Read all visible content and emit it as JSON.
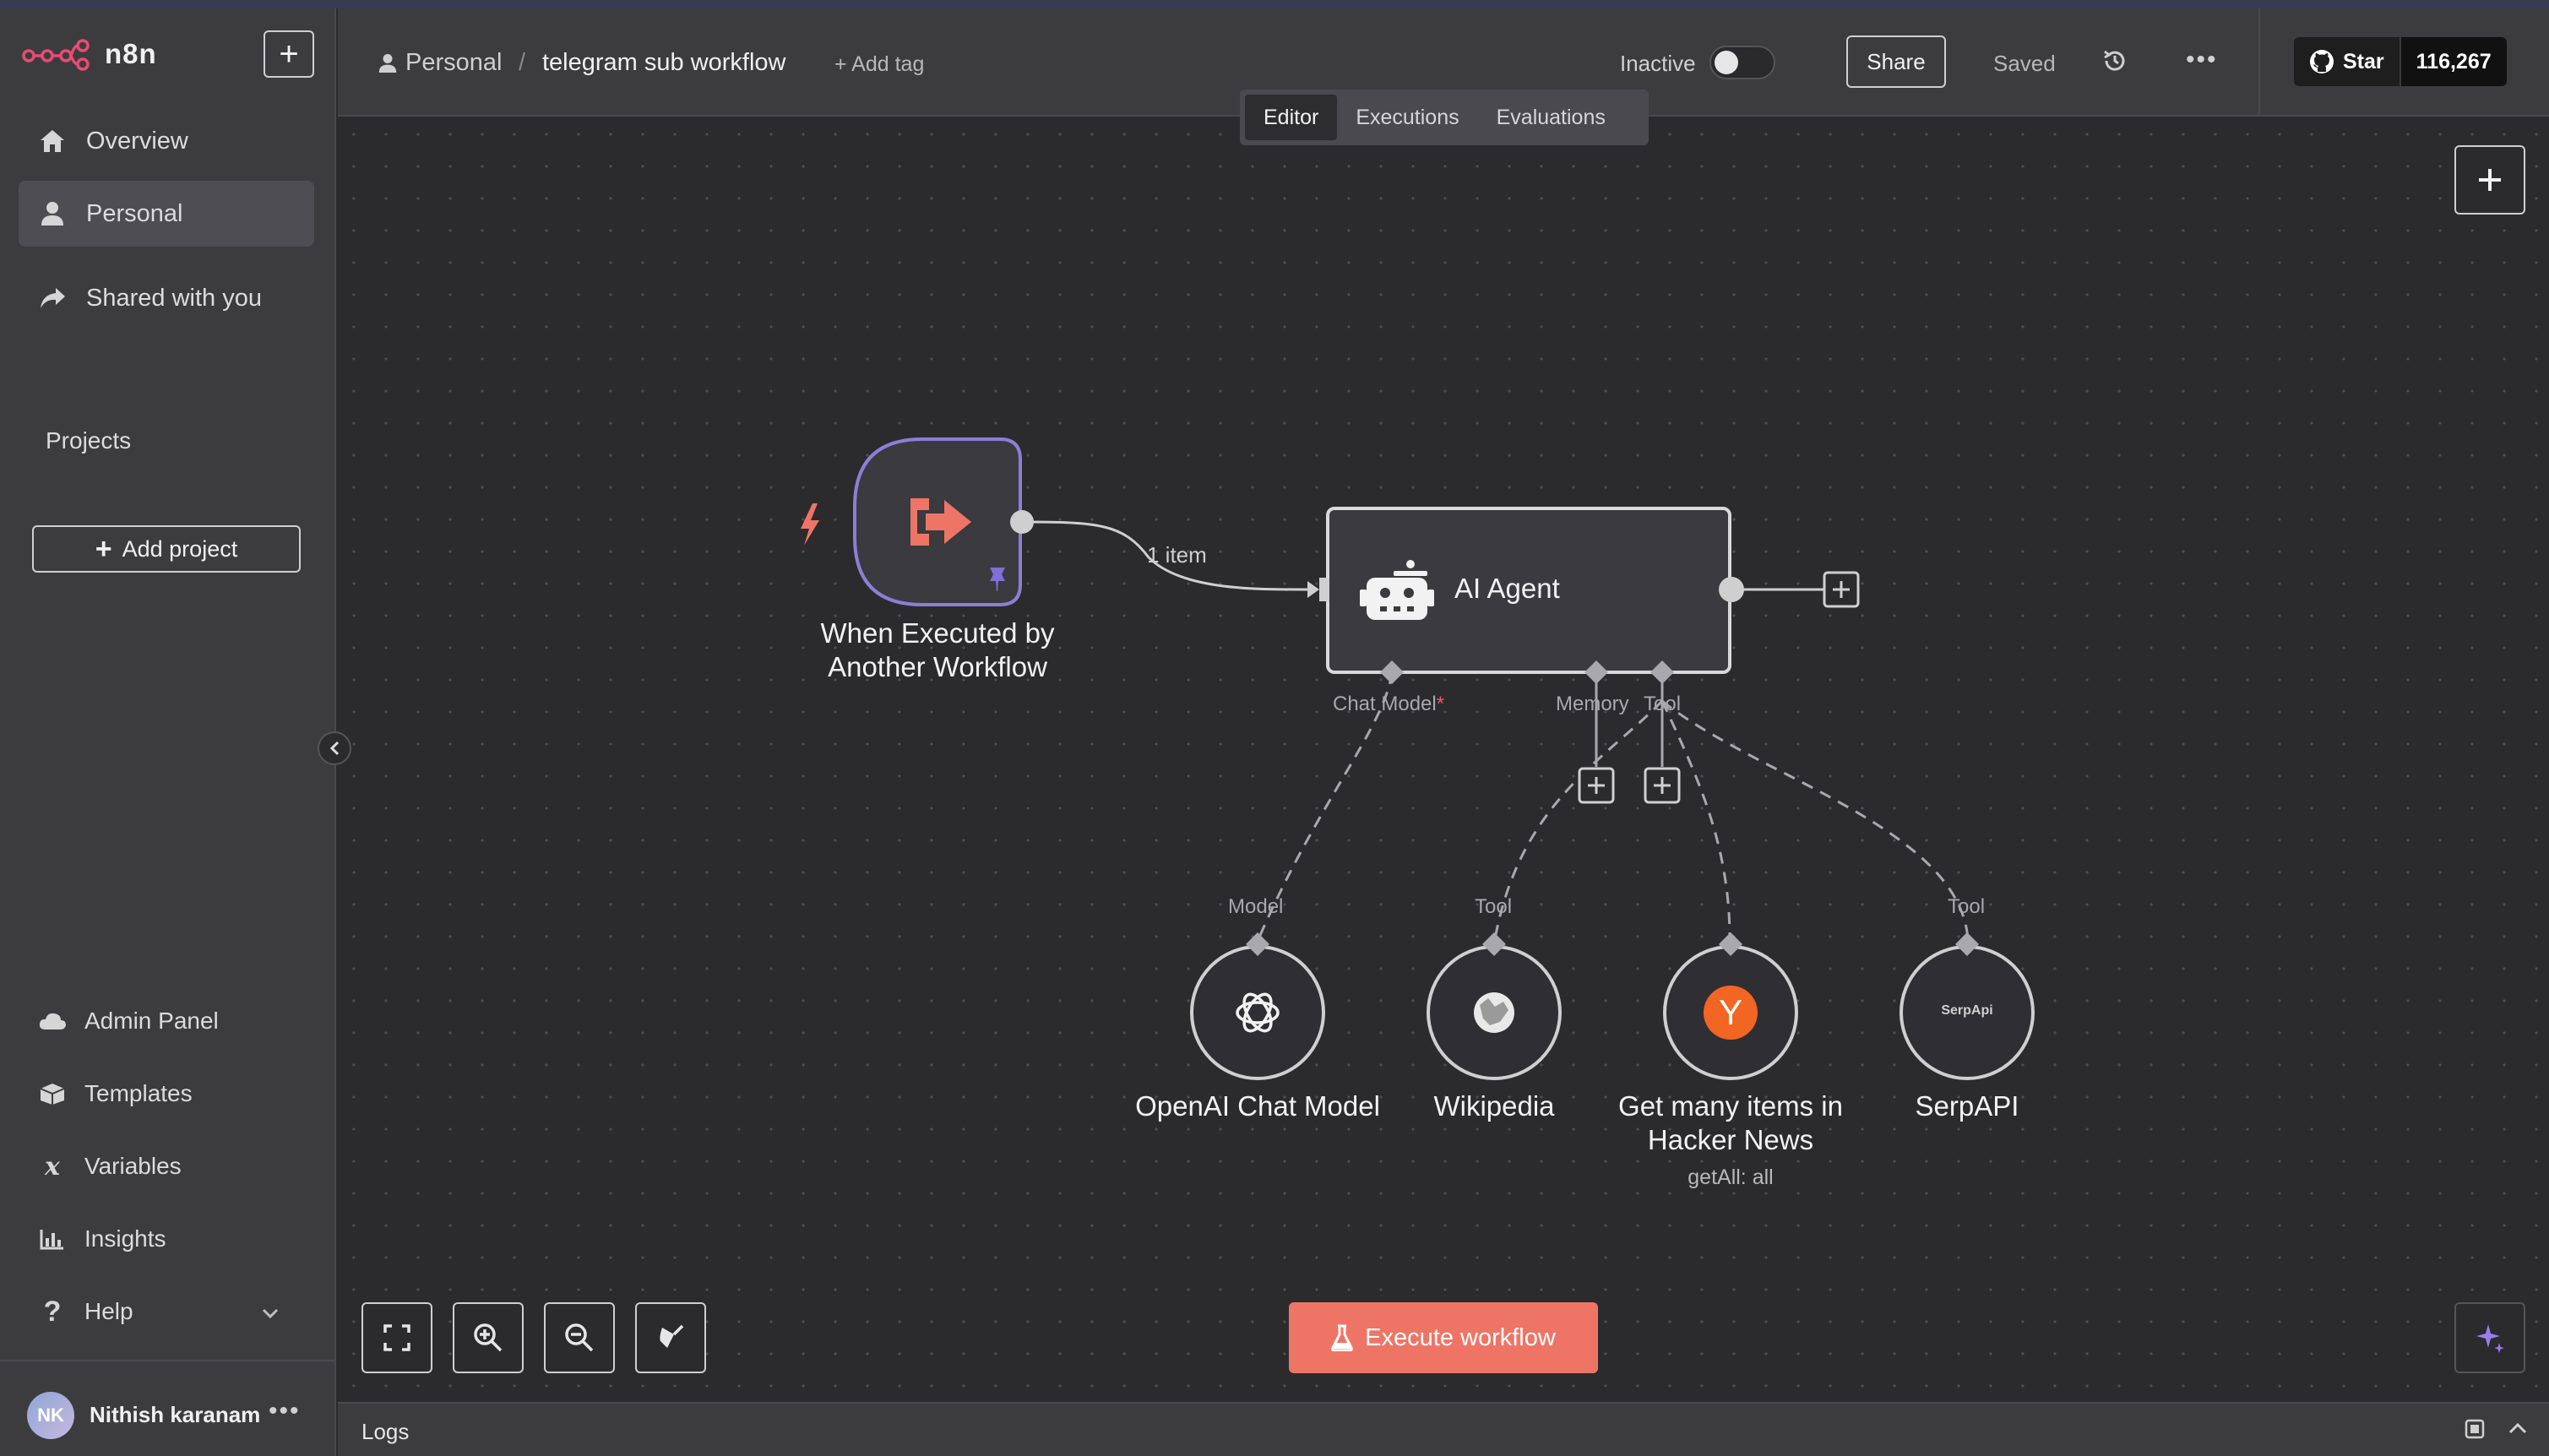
{
  "app": {
    "brand": "n8n",
    "accent": "#ee7566"
  },
  "sidebar": {
    "new_button": "+",
    "nav": [
      {
        "label": "Overview",
        "icon": "home-icon"
      },
      {
        "label": "Personal",
        "icon": "user-icon",
        "active": true
      },
      {
        "label": "Shared with you",
        "icon": "share-icon"
      }
    ],
    "projects_label": "Projects",
    "add_project_label": "Add project",
    "bottom_nav": [
      {
        "label": "Admin Panel",
        "icon": "cloud-icon"
      },
      {
        "label": "Templates",
        "icon": "box-icon"
      },
      {
        "label": "Variables",
        "icon": "variable-icon"
      },
      {
        "label": "Insights",
        "icon": "chart-icon"
      },
      {
        "label": "Help",
        "icon": "help-icon"
      }
    ],
    "user": {
      "initials": "NK",
      "name": "Nithish karanam"
    }
  },
  "header": {
    "breadcrumb_project": "Personal",
    "breadcrumb_sep": "/",
    "workflow_name": "telegram sub workflow",
    "add_tag": "+ Add tag",
    "status_label": "Inactive",
    "active": false,
    "share_label": "Share",
    "saved_label": "Saved",
    "github_star_label": "Star",
    "github_star_count": "116,267"
  },
  "tabs": [
    {
      "label": "Editor",
      "active": true
    },
    {
      "label": "Executions"
    },
    {
      "label": "Evaluations"
    }
  ],
  "canvas": {
    "trigger_node": {
      "label_line1": "When Executed by",
      "label_line2": "Another Workflow"
    },
    "edge_label": "1 item",
    "agent_node": {
      "label": "AI Agent"
    },
    "agent_ports": {
      "chat_model": "Chat Model",
      "required_mark": "*",
      "memory": "Memory",
      "tool": "Tool"
    },
    "sub_nodes": [
      {
        "label": "OpenAI Chat Model",
        "port": "Model",
        "icon": "openai-icon"
      },
      {
        "label": "Wikipedia",
        "port": "Tool",
        "icon": "wikipedia-icon"
      },
      {
        "label_line1": "Get many items in",
        "label_line2": "Hacker News",
        "sub": "getAll: all",
        "port": "",
        "icon": "hacker-news-icon",
        "icon_text": "Y"
      },
      {
        "label": "SerpAPI",
        "port": "Tool",
        "icon": "serpapi-icon",
        "icon_text": "SerpApi"
      }
    ],
    "execute_label": "Execute workflow"
  },
  "logs": {
    "label": "Logs"
  }
}
